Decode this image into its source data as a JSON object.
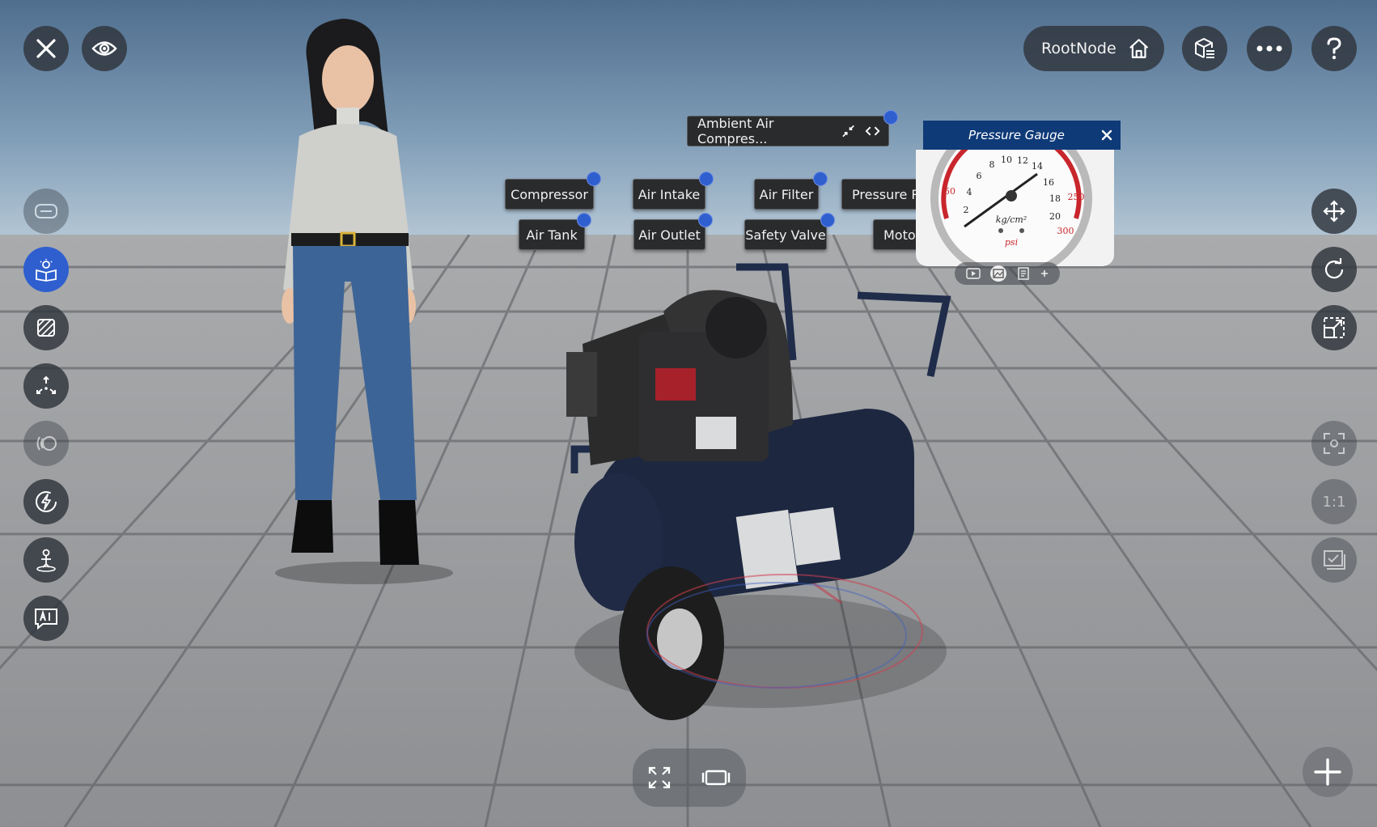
{
  "topbar": {
    "root_label": "RootNode"
  },
  "main_node": {
    "label": "Ambient Air Compres..."
  },
  "hotspots": [
    {
      "label": "Compressor"
    },
    {
      "label": "Air Intake"
    },
    {
      "label": "Air Filter"
    },
    {
      "label": "Pressure Reg"
    },
    {
      "label": "Air Tank"
    },
    {
      "label": "Air Outlet"
    },
    {
      "label": "Safety Valve"
    },
    {
      "label": "Motor"
    }
  ],
  "gauge_panel": {
    "title": "Pressure Gauge",
    "unit_top": "kg/cm²",
    "unit_bottom": "psi",
    "numbers": [
      "2",
      "4",
      "6",
      "8",
      "10",
      "12",
      "14",
      "16",
      "18",
      "20",
      "50",
      "250",
      "300"
    ]
  },
  "right_tools": {
    "ratio_label": "1:1"
  },
  "colors": {
    "accent": "#2f5fcf",
    "panel_header": "#0f3a78",
    "button_bg": "#30343c"
  }
}
